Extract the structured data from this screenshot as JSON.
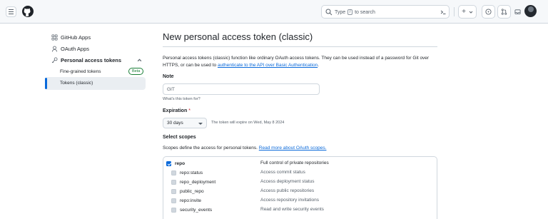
{
  "header": {
    "search_prefix": "Type",
    "search_key": "/",
    "search_suffix": "to search",
    "new_label": "+"
  },
  "sidebar": {
    "items": [
      {
        "label": "GitHub Apps",
        "icon": "apps-icon"
      },
      {
        "label": "OAuth Apps",
        "icon": "person-icon"
      },
      {
        "label": "Personal access tokens",
        "icon": "key-icon"
      }
    ],
    "sub_items": [
      {
        "label": "Fine-grained tokens",
        "badge": "Beta"
      },
      {
        "label": "Tokens (classic)"
      }
    ]
  },
  "main": {
    "title": "New personal access token (classic)",
    "description_text": "Personal access tokens (classic) function like ordinary OAuth access tokens. They can be used instead of a password for Git over HTTPS, or can be used to",
    "description_link": "authenticate to the API over Basic Authentication",
    "description_end": ".",
    "note_label": "Note",
    "note_value": "GIT",
    "note_hint": "What's this token for?",
    "expiration_label": "Expiration",
    "expiration_required": "*",
    "expiration_value": "30 days",
    "expiration_note": "The token will expire on Wed, May 8 2024",
    "scopes_label": "Select scopes",
    "scopes_desc": "Scopes define the access for personal tokens.",
    "scopes_link": "Read more about OAuth scopes.",
    "scopes": [
      {
        "name": "repo",
        "desc": "Full control of private repositories",
        "checked": true,
        "main": true
      },
      {
        "name": "repo:status",
        "desc": "Access commit status",
        "checked": true,
        "main": false
      },
      {
        "name": "repo_deployment",
        "desc": "Access deployment status",
        "checked": true,
        "main": false
      },
      {
        "name": "public_repo",
        "desc": "Access public repositories",
        "checked": true,
        "main": false
      },
      {
        "name": "repo:invite",
        "desc": "Access repository invitations",
        "checked": true,
        "main": false
      },
      {
        "name": "security_events",
        "desc": "Read and write security events",
        "checked": true,
        "main": false
      }
    ]
  },
  "colors": {
    "accent": "#0969da",
    "success": "#1a7f37",
    "danger": "#cf222e"
  }
}
